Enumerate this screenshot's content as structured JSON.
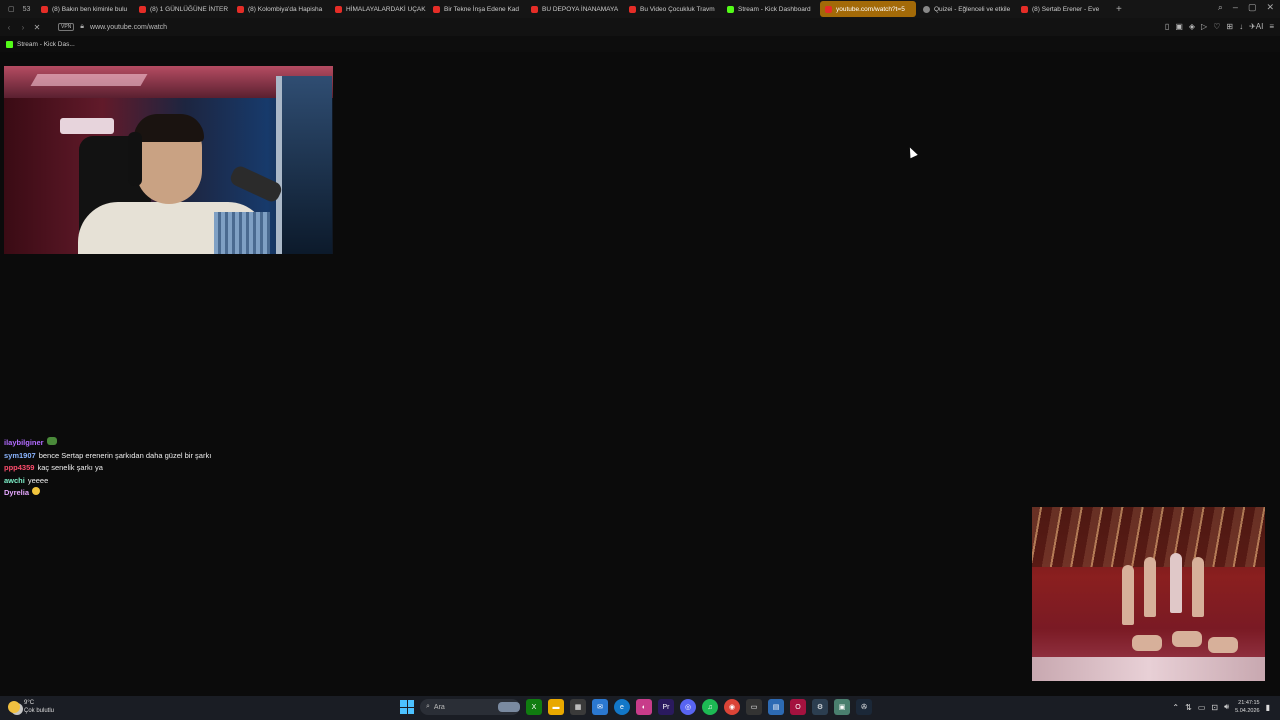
{
  "browser": {
    "tab_counter": "53",
    "tabs": [
      {
        "label": "(8) Bakın ben kiminle bulu",
        "icon": "youtube"
      },
      {
        "label": "(8) 1 GÜNLÜĞÜNE İNTER",
        "icon": "youtube"
      },
      {
        "label": "(8) Kolombiya'da Hapisha",
        "icon": "youtube"
      },
      {
        "label": "HİMALAYALARDAKİ UÇAK",
        "icon": "youtube"
      },
      {
        "label": "Bir Tekne İnşa Edene Kad",
        "icon": "youtube"
      },
      {
        "label": "BU DEPOYA İNANAMAYA",
        "icon": "youtube"
      },
      {
        "label": "Bu Video Çocukluk Travm",
        "icon": "youtube"
      },
      {
        "label": "Stream - Kick Dashboard",
        "icon": "kick"
      },
      {
        "label": "youtube.com/watch?t=5",
        "icon": "youtube",
        "active": true
      },
      {
        "label": "Quizei - Eğlenceli ve etkile",
        "icon": "generic"
      },
      {
        "label": "(8) Sertab Erener - Eve",
        "icon": "youtube"
      }
    ],
    "new_tab": "+",
    "vpn_label": "VPN",
    "url": "www.youtube.com/watch",
    "ai_label": "AI",
    "bookmark": "Stream - Kick Das..."
  },
  "chat": [
    {
      "user": "ilaybilginer",
      "color": "#b26bff",
      "message": "",
      "emote": "tank"
    },
    {
      "user": "sym1907",
      "color": "#8ab4ff",
      "message": "bence Sertap erenerin şarkıdan daha güzel bir şarkı",
      "emote": ""
    },
    {
      "user": "ppp4359",
      "color": "#ff4d6d",
      "message": "kaç senelik şarkı ya",
      "emote": ""
    },
    {
      "user": "awchi",
      "color": "#7ef0c9",
      "message": "yeeee",
      "emote": ""
    },
    {
      "user": "Dyrelia",
      "color": "#e6a8ff",
      "message": "",
      "emote": "face"
    }
  ],
  "taskbar": {
    "weather_temp": "9°C",
    "weather_desc": "Çok bulutlu",
    "search_placeholder": "Ara",
    "time": "21:47:15",
    "date": "5.04.2026"
  },
  "colors": {
    "active_tab": "#a36a08",
    "youtube_red": "#e52d27",
    "kick_green": "#53fc18",
    "taskbar_bg": "#1a1d24"
  }
}
